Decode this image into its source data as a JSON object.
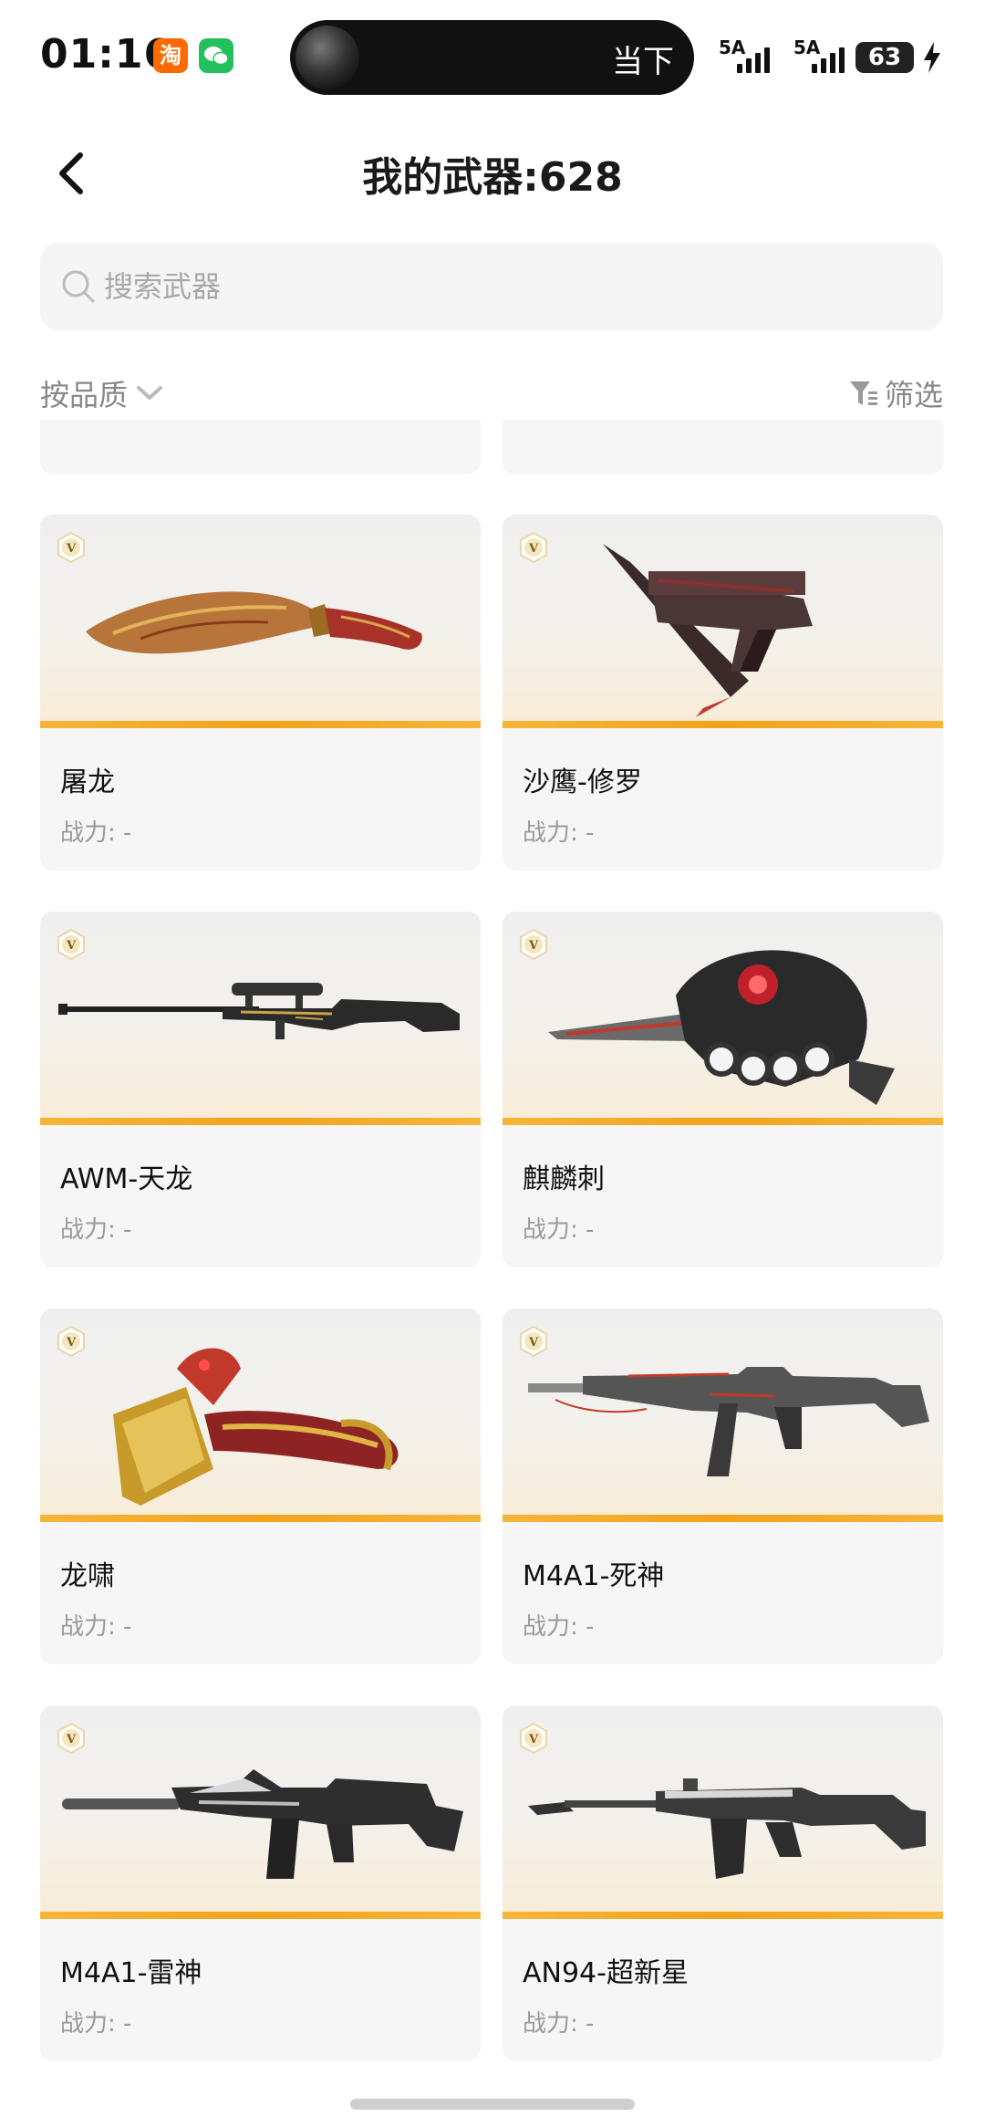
{
  "status_bar": {
    "time": "01:16",
    "app_badges": [
      {
        "name": "taobao-icon",
        "char": "淘",
        "color": "#ff6a00"
      },
      {
        "name": "wechat-icon",
        "char": "",
        "color": "#22c15e"
      }
    ],
    "now_playing": "当下",
    "signal": [
      "5A",
      "5A"
    ],
    "battery": "63"
  },
  "header": {
    "back_icon": "chevron-left-icon",
    "title": "我的武器:628"
  },
  "search": {
    "placeholder": "搜索武器"
  },
  "toolbar": {
    "sort_label": "按品质",
    "filter_label": "筛选"
  },
  "weapons": [
    {
      "name": "屠龙",
      "power_label": "战力: -",
      "icon": "kukri-knife-image"
    },
    {
      "name": "沙鹰-修罗",
      "power_label": "战力: -",
      "icon": "desert-eagle-pistol-image"
    },
    {
      "name": "AWM-天龙",
      "power_label": "战力: -",
      "icon": "sniper-rifle-image"
    },
    {
      "name": "麒麟刺",
      "power_label": "战力: -",
      "icon": "knuckle-blade-image"
    },
    {
      "name": "龙啸",
      "power_label": "战力: -",
      "icon": "dragon-axe-image"
    },
    {
      "name": "M4A1-死神",
      "power_label": "战力: -",
      "icon": "assault-rifle-image"
    },
    {
      "name": "M4A1-雷神",
      "power_label": "战力: -",
      "icon": "assault-rifle-image"
    },
    {
      "name": "AN94-超新星",
      "power_label": "战力: -",
      "icon": "assault-rifle-image"
    }
  ],
  "colors": {
    "accent_stripe": "#f2a31a",
    "card_bg": "#f6f6f6",
    "muted_text": "#999999",
    "badge_gold": "#c99a2e"
  }
}
